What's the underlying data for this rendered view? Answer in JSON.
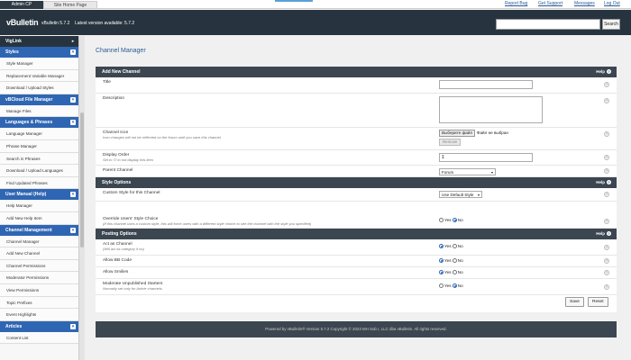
{
  "topbar": {
    "tabs": [
      "Admin CP",
      "Site Home Page"
    ],
    "links": [
      "Report Bug",
      "Get Support",
      "Messages",
      "Log Out"
    ]
  },
  "header": {
    "logo": "vBulletin",
    "version": "vBulletin 5.7.2",
    "latest": "Latest version available: 5.7.2",
    "search_button": "Search",
    "search_value": ""
  },
  "sidebar": {
    "groups": [
      {
        "title": "VigLink",
        "style": "dark",
        "items": []
      },
      {
        "title": "Styles",
        "style": "blue",
        "items": [
          "Style Manager",
          "Replacement Variable Manager",
          "Download / Upload Styles"
        ]
      },
      {
        "title": "vBCloud File Manager",
        "style": "blue",
        "items": [
          "Manage Files"
        ]
      },
      {
        "title": "Languages & Phrases",
        "style": "blue",
        "items": [
          "Language Manager",
          "Phrase Manager",
          "Search in Phrases",
          "Download / Upload Languages",
          "Find Updated Phrases"
        ]
      },
      {
        "title": "User Manual (Help)",
        "style": "blue",
        "items": [
          "Help Manager",
          "Add New Help Item"
        ]
      },
      {
        "title": "Channel Management",
        "style": "blue",
        "items": [
          "Channel Manager",
          "Add New Channel",
          "Channel Permissions",
          "Moderator Permissions",
          "View Permissions",
          "Topic Prefixes",
          "Event Highlights"
        ]
      },
      {
        "title": "Articles",
        "style": "blue",
        "items": [
          "Content List"
        ]
      }
    ]
  },
  "main": {
    "page_title": "Channel Manager",
    "help_label": "Help",
    "add_section": {
      "title": "Add New Channel",
      "title_label": "Title",
      "description_label": "Description",
      "icon_label": "Channel Icon",
      "icon_note": "Icon changes will not be reflected on the forum until you save this channel.",
      "file_button": "Выберите файл",
      "file_status": "Файл не выбран",
      "remove_button": "Remove",
      "display_order_label": "Display Order",
      "display_order_note": "Set to '0' to not display this item",
      "display_order_value": "1",
      "parent_label": "Parent Channel",
      "parent_value": "Forum"
    },
    "style_section": {
      "title": "Style Options",
      "custom_style_label": "Custom Style for this Channel",
      "custom_style_value": "Use Default Style",
      "override_label": "Override Users' Style Choice",
      "override_note": "(If this channel uses a custom style, this will force users with a different style choice to see the channel with the style you specified)",
      "yes": "Yes",
      "no": "No"
    },
    "posting_section": {
      "title": "Posting Options",
      "act_label": "Act as Channel",
      "act_note": "(Will act as category if no)",
      "bbcode_label": "Allow BB Code",
      "smilies_label": "Allow Smilies",
      "moderate_label": "Moderate Unpublished Starters",
      "moderate_note": "Normally set only for Article channels.",
      "yes": "Yes",
      "no": "No"
    },
    "save_button": "Save",
    "reset_button": "Reset",
    "footer": "Powered by vBulletin® Version 5.7.2 Copyright © 2023 MH Sub I, LLC dba vBulletin. All rights reserved."
  }
}
